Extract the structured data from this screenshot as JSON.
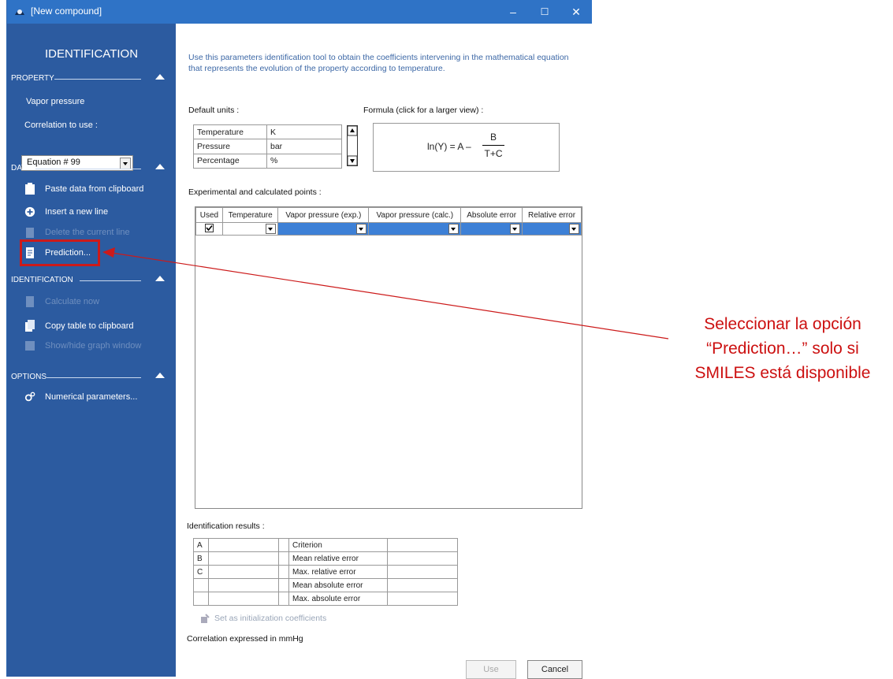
{
  "window": {
    "title": "[New compound]",
    "minimize": "–",
    "maximize": "☐",
    "close": "✕"
  },
  "sidebar": {
    "heading": "IDENTIFICATION",
    "property": {
      "title": "PROPERTY",
      "name": "Vapor pressure",
      "correlation_label": "Correlation to use :",
      "correlation_value": "Equation # 99"
    },
    "data": {
      "title": "DATA",
      "items": [
        {
          "label": "Paste data from clipboard",
          "icon": "clipboard-icon",
          "enabled": true
        },
        {
          "label": "Insert a new line",
          "icon": "plus-circle-icon",
          "enabled": true
        },
        {
          "label": "Delete the current line",
          "icon": "delete-icon",
          "enabled": false
        },
        {
          "label": "Prediction...",
          "icon": "prediction-icon",
          "enabled": true
        }
      ]
    },
    "identification": {
      "title": "IDENTIFICATION",
      "items": [
        {
          "label": "Calculate now",
          "icon": "calculator-icon",
          "enabled": false
        },
        {
          "label": "Copy table to clipboard",
          "icon": "copy-icon",
          "enabled": true
        },
        {
          "label": "Show/hide graph window",
          "icon": "graph-icon",
          "enabled": false
        }
      ]
    },
    "options": {
      "title": "OPTIONS",
      "items": [
        {
          "label": "Numerical parameters...",
          "icon": "gears-icon",
          "enabled": true
        }
      ]
    }
  },
  "main": {
    "intro": "Use this parameters identification tool to obtain the coefficients intervening in the mathematical equation that represents the evolution of the property according to temperature.",
    "default_units_label": "Default units :",
    "units": [
      {
        "name": "Temperature",
        "unit": "K"
      },
      {
        "name": "Pressure",
        "unit": "bar"
      },
      {
        "name": "Percentage",
        "unit": "%"
      }
    ],
    "formula_label": "Formula (click for a larger view) :",
    "formula": {
      "lhs": "ln(Y) = A –",
      "numerator": "B",
      "denominator": "T+C"
    },
    "points_label": "Experimental and calculated points :",
    "points_columns": [
      "Used",
      "Temperature",
      "Vapor pressure (exp.)",
      "Vapor pressure (calc.)",
      "Absolute error",
      "Relative error"
    ],
    "results_label": "Identification results :",
    "results": [
      {
        "coef": "A",
        "value": "",
        "criterion": "Criterion",
        "criterion_value": ""
      },
      {
        "coef": "B",
        "value": "",
        "criterion": "Mean relative error",
        "criterion_value": ""
      },
      {
        "coef": "C",
        "value": "",
        "criterion": "Max. relative error",
        "criterion_value": ""
      },
      {
        "coef": "",
        "value": "",
        "criterion": "Mean absolute error",
        "criterion_value": ""
      },
      {
        "coef": "",
        "value": "",
        "criterion": "Max. absolute error",
        "criterion_value": ""
      }
    ],
    "set_init_label": "Set as initialization coefficients",
    "correlation_note": "Correlation expressed in mmHg",
    "use_button": "Use",
    "cancel_button": "Cancel"
  },
  "annotation": {
    "line1": "Seleccionar la opción",
    "line2": "“Prediction…” solo si",
    "line3": "SMILES está disponible",
    "color": "#cc1010"
  }
}
